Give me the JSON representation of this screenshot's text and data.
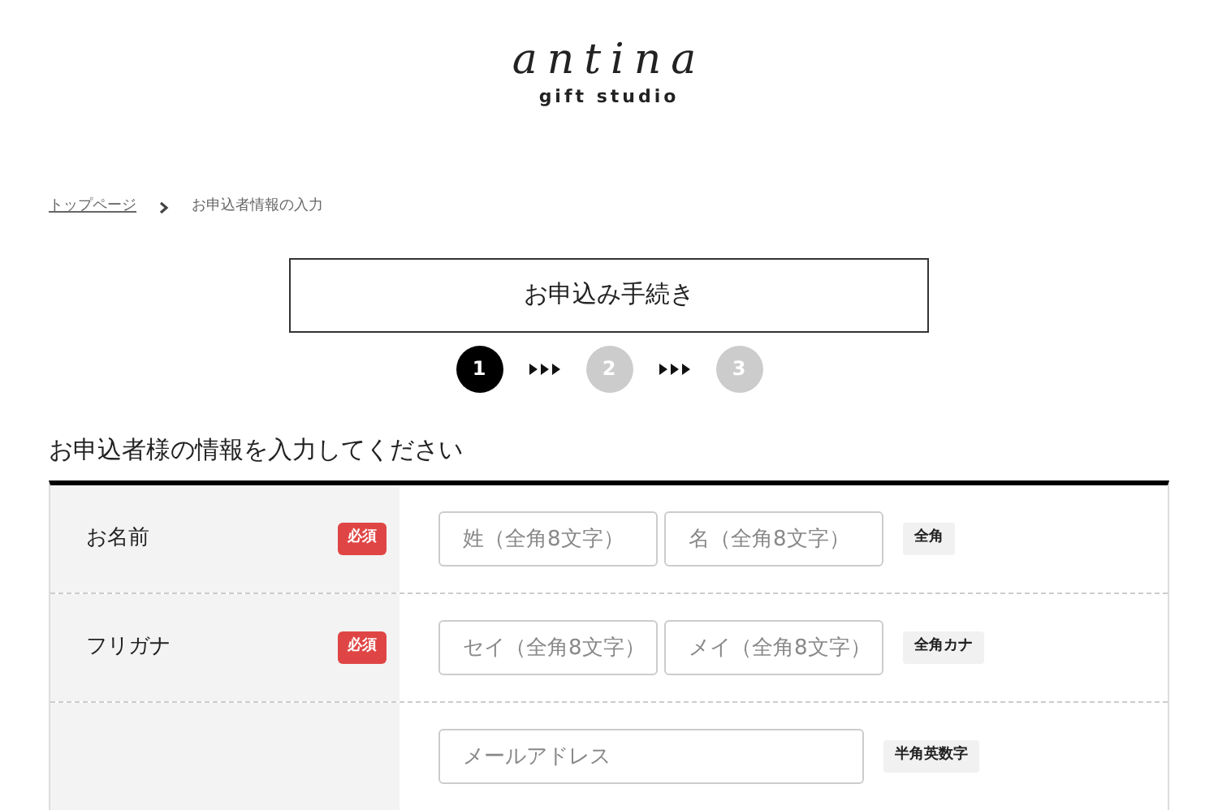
{
  "logo": {
    "name": "antina",
    "tagline": "gift studio"
  },
  "breadcrumb": [
    {
      "label": "トップページ",
      "link": true
    },
    {
      "label": "お申込者情報の入力",
      "link": false
    }
  ],
  "procedure_title": "お申込み手続き",
  "steps": [
    {
      "label": "1",
      "selected": true
    },
    {
      "label": "2",
      "selected": false
    },
    {
      "label": "3",
      "selected": false
    }
  ],
  "section_heading": "お申込者様の情報を入力してください",
  "form_rows": [
    {
      "kind": "pair",
      "label": "お名前",
      "required": true,
      "required_label": "必須",
      "inputs": [
        {
          "placeholder": "姓（全角8文字）"
        },
        {
          "placeholder": "名（全角8文字）"
        }
      ],
      "note": "全角"
    },
    {
      "kind": "pair",
      "label": "フリガナ",
      "required": true,
      "required_label": "必須",
      "inputs": [
        {
          "placeholder": "セイ（全角8文字）"
        },
        {
          "placeholder": "メイ（全角8文字）"
        }
      ],
      "note": "全角カナ"
    },
    {
      "kind": "wide",
      "required": false,
      "inputs": [
        {
          "placeholder": "メールアドレス"
        }
      ],
      "note": "半角英数字"
    }
  ]
}
